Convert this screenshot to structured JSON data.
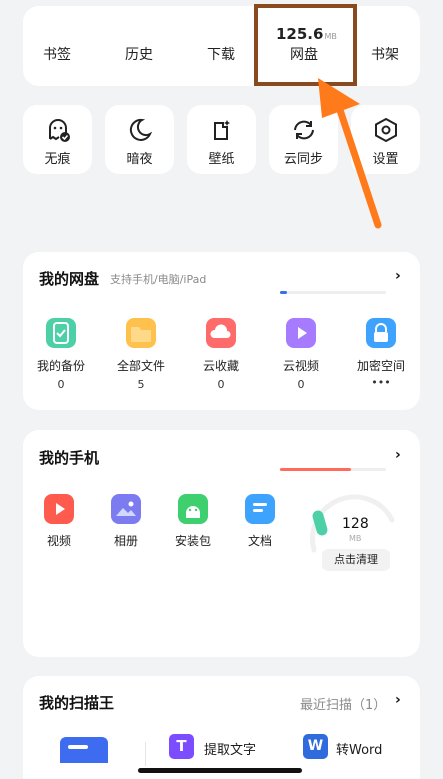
{
  "nav": {
    "bookmarks": "书签",
    "history": "历史",
    "downloads": "下载",
    "net_disk": "网盘",
    "net_disk_size": "125.6",
    "net_disk_unit": "MB",
    "bookshelf": "书架"
  },
  "tools": [
    {
      "label": "无痕",
      "icon": "ghost-icon"
    },
    {
      "label": "暗夜",
      "icon": "moon-icon"
    },
    {
      "label": "壁纸",
      "icon": "wallpaper-icon"
    },
    {
      "label": "云同步",
      "icon": "sync-icon"
    },
    {
      "label": "设置",
      "icon": "settings-hexagon-icon"
    }
  ],
  "disk": {
    "title": "我的网盘",
    "subtitle": "支持手机/电脑/iPad",
    "items": [
      {
        "label": "我的备份",
        "count": "0",
        "color": "#4dd0a8",
        "icon": "backup-icon"
      },
      {
        "label": "全部文件",
        "count": "5",
        "color": "#ffc14d",
        "icon": "folder-icon"
      },
      {
        "label": "云收藏",
        "count": "0",
        "color": "#ff6b6b",
        "icon": "cloud-favorite-icon"
      },
      {
        "label": "云视频",
        "count": "0",
        "color": "#a77bff",
        "icon": "cloud-video-icon"
      },
      {
        "label": "加密空间",
        "count": "•••",
        "color": "#3ea2ff",
        "icon": "lock-icon"
      }
    ]
  },
  "phone": {
    "title": "我的手机",
    "items": [
      {
        "label": "视频",
        "color": "#ff5a4e",
        "icon": "video-icon"
      },
      {
        "label": "相册",
        "color": "#7c7cf0",
        "icon": "album-icon"
      },
      {
        "label": "安装包",
        "color": "#3ecf6e",
        "icon": "android-package-icon"
      },
      {
        "label": "文档",
        "color": "#3ea2ff",
        "icon": "document-icon"
      }
    ],
    "storage_value": "128",
    "storage_unit": "MB",
    "clean_label": "点击清理"
  },
  "scanner": {
    "title": "我的扫描王",
    "recent": "最近扫描（1）",
    "extract_text": "提取文字",
    "to_word": "转Word"
  }
}
